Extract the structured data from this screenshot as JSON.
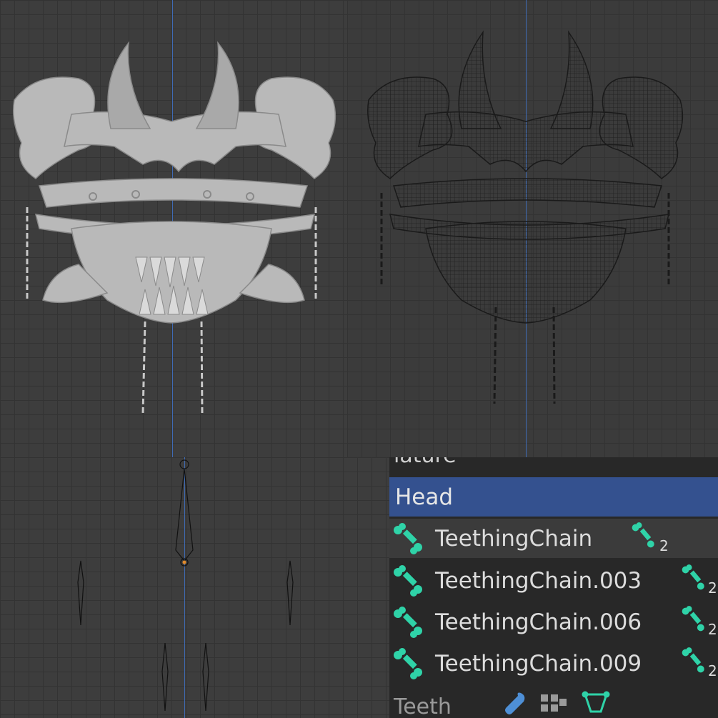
{
  "viewports": {
    "solid": {
      "name": "solid-viewport"
    },
    "wireframe": {
      "name": "wireframe-viewport"
    },
    "armature": {
      "name": "armature-viewport"
    }
  },
  "outliner": {
    "top_partial": "iature",
    "selected_item": "Head",
    "items": [
      {
        "label": "TeethingChain",
        "child_count": "2"
      },
      {
        "label": "TeethingChain.003",
        "child_count": "2"
      },
      {
        "label": "TeethingChain.006",
        "child_count": "2"
      },
      {
        "label": "TeethingChain.009",
        "child_count": "2"
      }
    ],
    "bottom_partial": "Teeth",
    "bone_icon": "bone-icon",
    "modifier_icon": "wrench-icon",
    "vertex_group_icon": "vertex-groups-icon",
    "armature_data_icon": "armature-data-icon"
  },
  "colors": {
    "selected_row": "#34518f",
    "bone_icon": "#2fd3a8",
    "axis_line": "#3f6bb5"
  }
}
